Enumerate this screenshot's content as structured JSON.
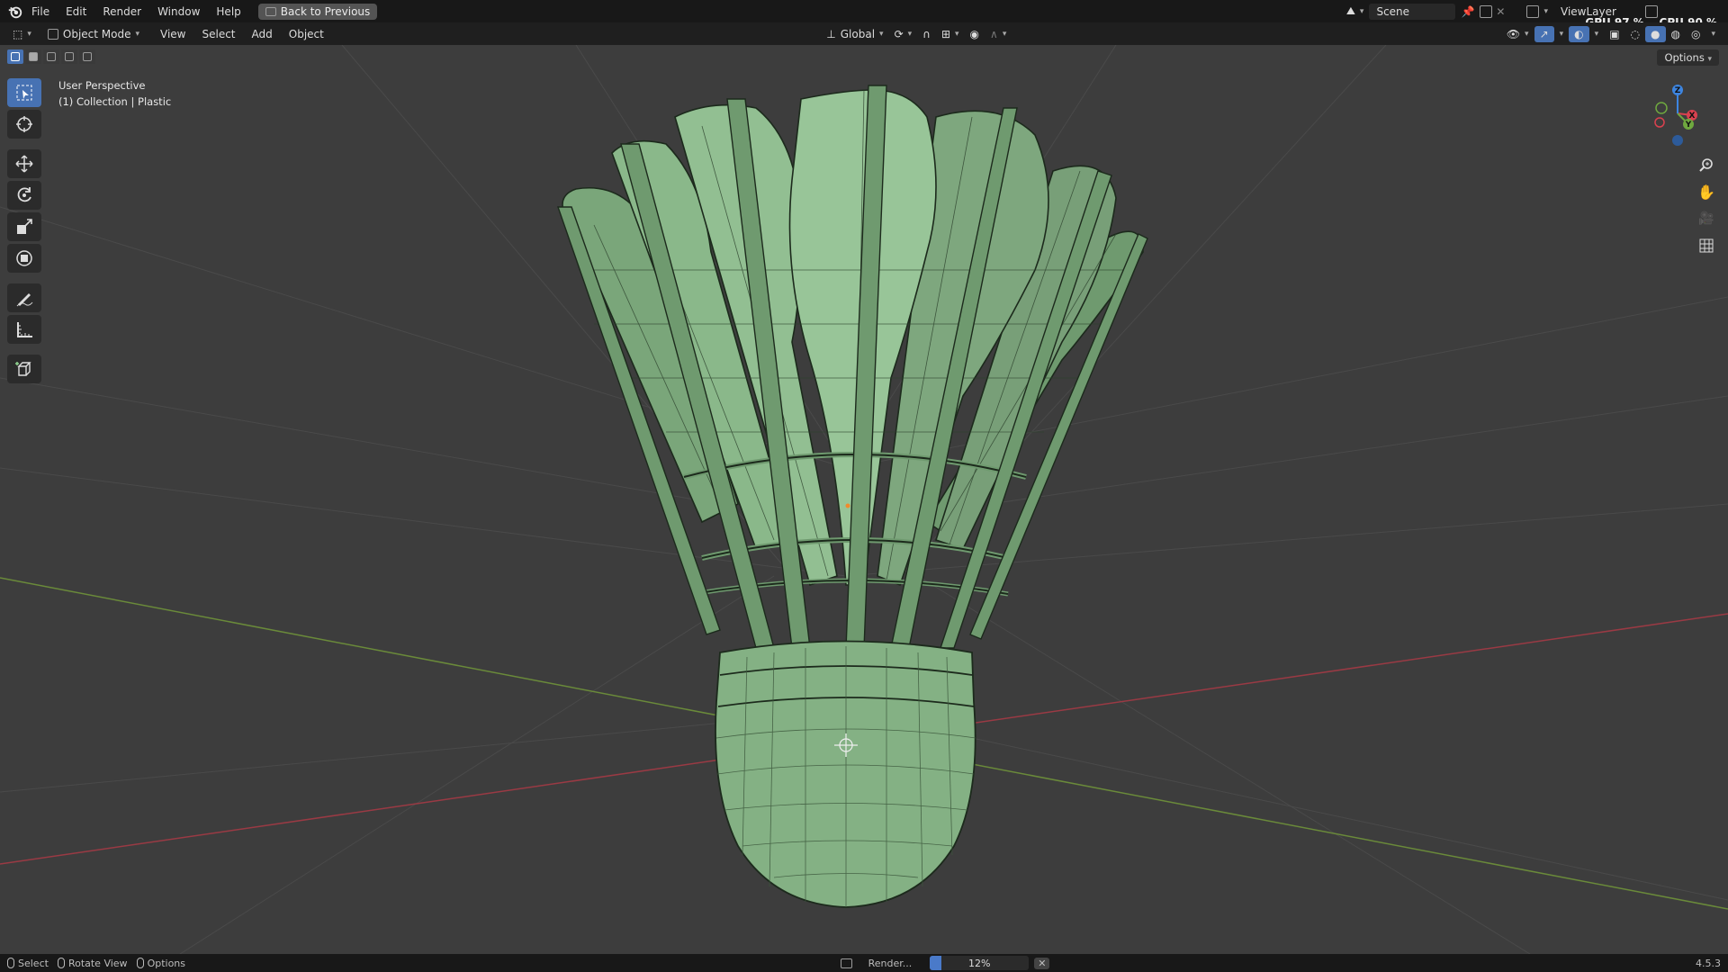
{
  "topbar": {
    "menus": [
      "File",
      "Edit",
      "Render",
      "Window",
      "Help"
    ],
    "back_button": "Back to Previous",
    "scene": "Scene",
    "view_layer": "ViewLayer",
    "gpu_label": "GPU",
    "gpu_value": "97 %",
    "cpu_label": "CPU",
    "cpu_value": "90 %"
  },
  "header": {
    "mode": "Object Mode",
    "menus": [
      "View",
      "Select",
      "Add",
      "Object"
    ],
    "transform_orientation": "Global",
    "options": "Options"
  },
  "viewport": {
    "perspective": "User Perspective",
    "collection": "(1) Collection | Plastic",
    "object_color": "#7fb07f",
    "gizmo_axes": [
      "X",
      "Y",
      "Z"
    ]
  },
  "tools": [
    "select-box",
    "cursor",
    "move",
    "rotate",
    "scale",
    "transform",
    "annotate",
    "measure",
    "add-cube"
  ],
  "status": {
    "select": "Select",
    "rotate_view": "Rotate View",
    "options": "Options",
    "render_label": "Render...",
    "progress_text": "12%",
    "progress_value": 0.12,
    "version": "4.5.3"
  },
  "colors": {
    "accent": "#4772b3",
    "x_axis": "#d9414f",
    "y_axis": "#6fa83f",
    "z_axis": "#3d85e0"
  }
}
